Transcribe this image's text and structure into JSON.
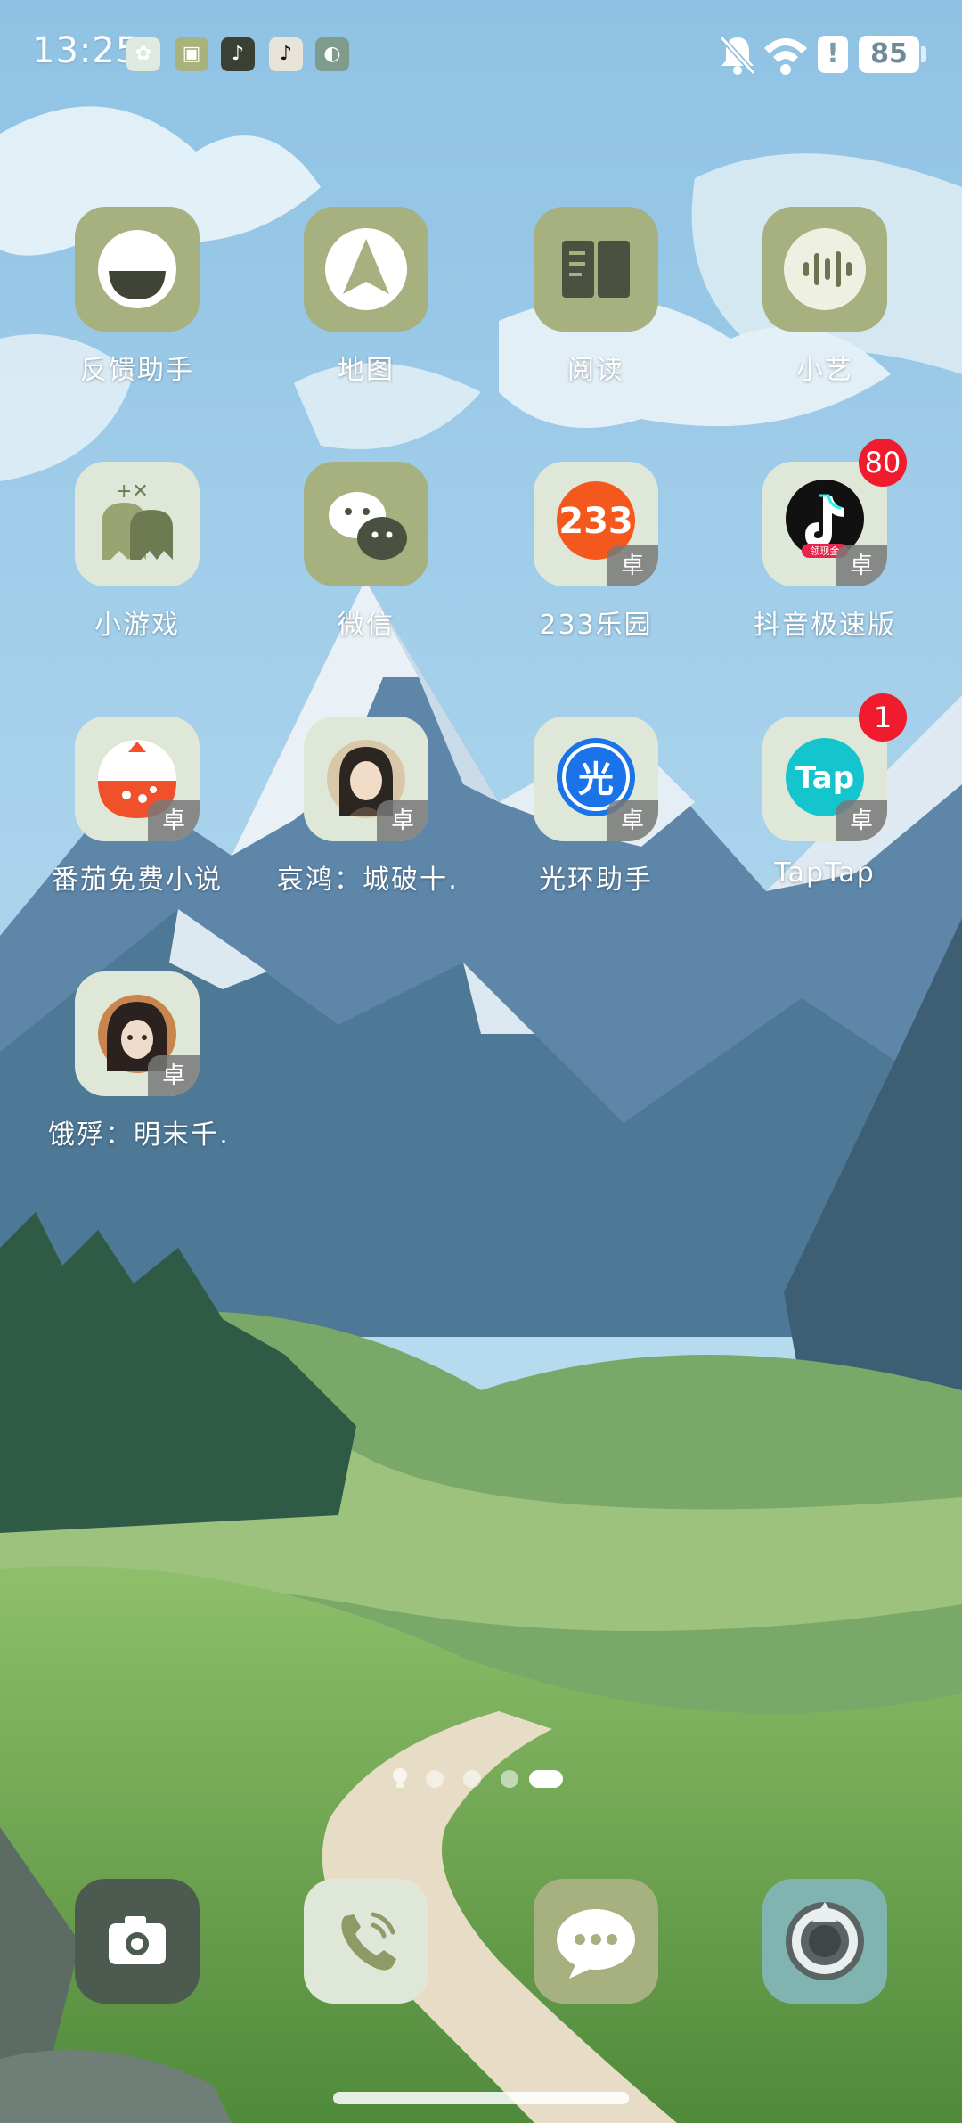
{
  "status_bar": {
    "time": "13:25",
    "battery": "85",
    "notification_icons": [
      "assistant-icon",
      "widget-icon",
      "douyin-icon",
      "douyin-lite-icon",
      "lens-icon"
    ]
  },
  "row1": [
    {
      "label": "反馈助手"
    },
    {
      "label": "地图"
    },
    {
      "label": "阅读"
    },
    {
      "label": "小艺"
    }
  ],
  "row2": [
    {
      "label": "小游戏"
    },
    {
      "label": "微信"
    },
    {
      "label": "233乐园",
      "icon_text": "233",
      "tag": "卓"
    },
    {
      "label": "抖音极速版",
      "tag": "卓",
      "badge": "80",
      "icon_subtext": "领现金"
    }
  ],
  "row3": [
    {
      "label": "番茄免费小说",
      "tag": "卓"
    },
    {
      "label": "哀鸿：城破十…",
      "tag": "卓"
    },
    {
      "label": "光环助手",
      "icon_text": "光",
      "tag": "卓"
    },
    {
      "label": "TapTap",
      "icon_text": "Tap",
      "tag": "卓",
      "badge": "1"
    }
  ],
  "row4": [
    {
      "label": "饿殍：明末千…",
      "tag": "卓"
    }
  ],
  "dock": [
    "camera",
    "phone",
    "messages",
    "browser"
  ],
  "colors": {
    "icon_olive": "#a7b07f",
    "icon_light": "#dfe8d8",
    "badge_red": "#f01b2d"
  }
}
